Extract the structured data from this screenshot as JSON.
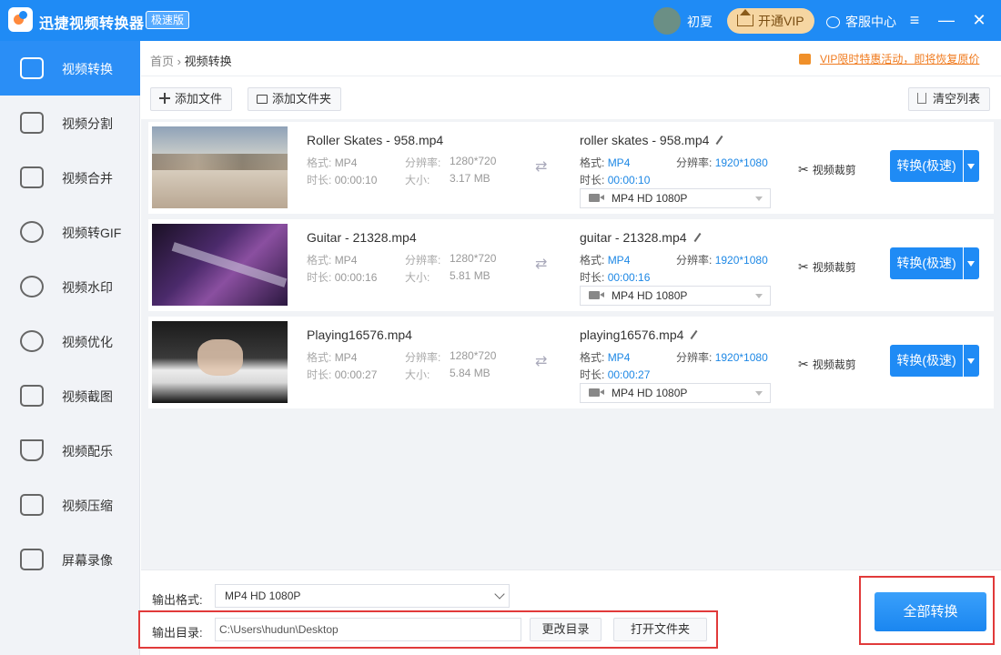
{
  "app": {
    "title": "迅捷视频转换器",
    "edition": "极速版",
    "username": "初夏",
    "vip_label": "开通VIP",
    "service_label": "客服中心"
  },
  "sidebar": {
    "items": [
      {
        "label": "视频转换",
        "icon": "video-convert-icon",
        "active": true
      },
      {
        "label": "视频分割",
        "icon": "video-split-icon"
      },
      {
        "label": "视频合并",
        "icon": "video-merge-icon"
      },
      {
        "label": "视频转GIF",
        "icon": "gif-icon"
      },
      {
        "label": "视频水印",
        "icon": "watermark-icon"
      },
      {
        "label": "视频优化",
        "icon": "film-reel-icon"
      },
      {
        "label": "视频截图",
        "icon": "screenshot-icon"
      },
      {
        "label": "视频配乐",
        "icon": "music-icon"
      },
      {
        "label": "视频压缩",
        "icon": "compress-icon"
      },
      {
        "label": "屏幕录像",
        "icon": "screen-record-icon"
      }
    ]
  },
  "breadcrumb": {
    "home": "首页",
    "separator": "›",
    "current": "视频转换"
  },
  "promo": "VIP限时特惠活动，即将恢复原价",
  "toolbar": {
    "add_file": "添加文件",
    "add_folder": "添加文件夹",
    "clear_list": "清空列表"
  },
  "labels": {
    "format": "格式:",
    "resolution": "分辨率:",
    "duration": "时长:",
    "size": "大小:",
    "crop": "视频裁剪",
    "convert": "转换(极速)"
  },
  "files": [
    {
      "src_name": "Roller Skates - 958.mp4",
      "src_format": "MP4",
      "src_resolution": "1280*720",
      "src_duration": "00:00:10",
      "src_size": "3.17 MB",
      "out_name": "roller skates - 958.mp4",
      "out_format": "MP4",
      "out_resolution": "1920*1080",
      "out_duration": "00:00:10",
      "preset": "MP4   HD 1080P"
    },
    {
      "src_name": "Guitar - 21328.mp4",
      "src_format": "MP4",
      "src_resolution": "1280*720",
      "src_duration": "00:00:16",
      "src_size": "5.81 MB",
      "out_name": "guitar - 21328.mp4",
      "out_format": "MP4",
      "out_resolution": "1920*1080",
      "out_duration": "00:00:16",
      "preset": "MP4   HD 1080P"
    },
    {
      "src_name": "Playing16576.mp4",
      "src_format": "MP4",
      "src_resolution": "1280*720",
      "src_duration": "00:00:27",
      "src_size": "5.84 MB",
      "out_name": "playing16576.mp4",
      "out_format": "MP4",
      "out_resolution": "1920*1080",
      "out_duration": "00:00:27",
      "preset": "MP4   HD 1080P"
    }
  ],
  "bottom": {
    "output_format_label": "输出格式:",
    "output_format_value": "MP4   HD 1080P",
    "output_dir_label": "输出目录:",
    "output_dir_value": "C:\\Users\\hudun\\Desktop",
    "change_dir": "更改目录",
    "open_folder": "打开文件夹",
    "convert_all": "全部转换"
  },
  "colors": {
    "accent": "#1f8bf5",
    "highlight": "#e13a3a",
    "vip": "#f6d6a2"
  }
}
